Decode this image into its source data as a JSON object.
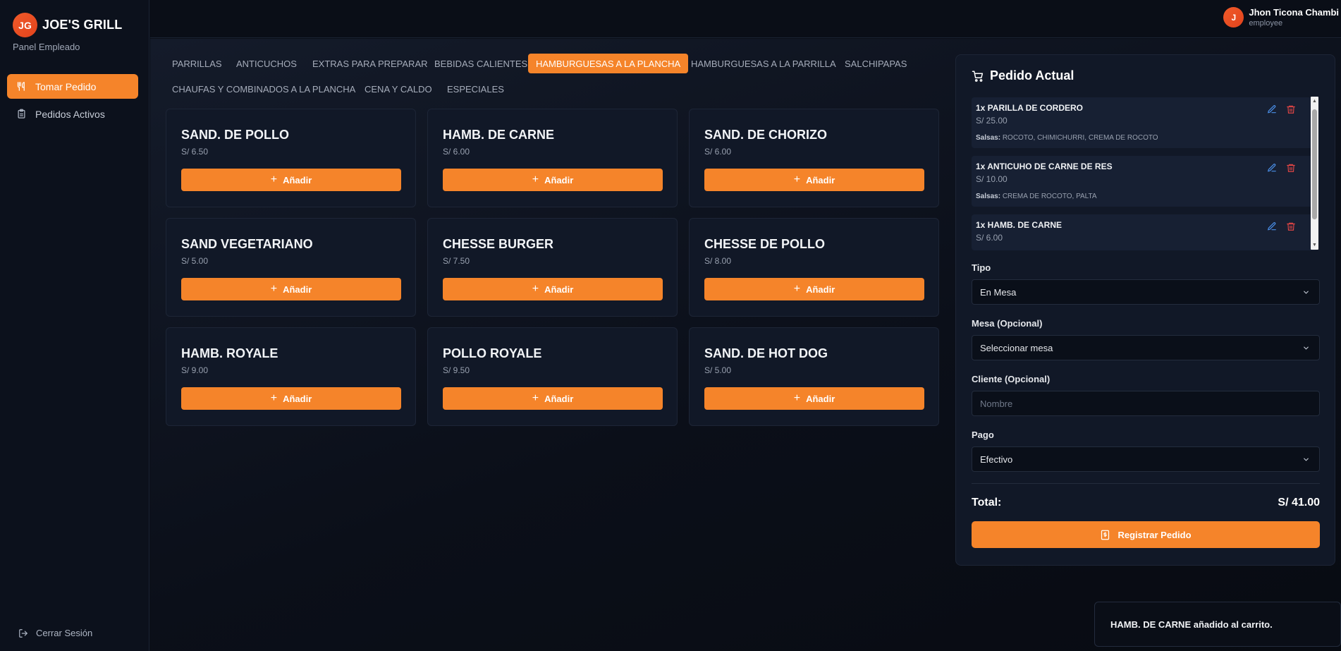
{
  "app": {
    "brand_initials": "JG",
    "brand_name": "JOE'S GRILL",
    "panel_label": "Panel Empleado"
  },
  "colors": {
    "accent": "#f5842a",
    "background": "#0a0e17",
    "card": "#111827",
    "danger": "#e04545",
    "edit": "#4a8fe8"
  },
  "sidebar": {
    "items": [
      {
        "label": "Tomar Pedido",
        "icon": "utensils-icon",
        "active": true
      },
      {
        "label": "Pedidos Activos",
        "icon": "clipboard-icon",
        "active": false
      }
    ],
    "logout_label": "Cerrar Sesión"
  },
  "user": {
    "initial": "J",
    "name": "Jhon Ticona Chambi",
    "role": "employee"
  },
  "categories": [
    {
      "label": "PARRILLAS",
      "active": false
    },
    {
      "label": "ANTICUCHOS",
      "active": false
    },
    {
      "label": "EXTRAS PARA PREPARAR",
      "active": false
    },
    {
      "label": "BEBIDAS CALIENTES",
      "active": false
    },
    {
      "label": "HAMBURGUESAS A LA PLANCHA",
      "active": true
    },
    {
      "label": "HAMBURGUESAS A LA PARRILLA",
      "active": false
    },
    {
      "label": "SALCHIPAPAS",
      "active": false
    },
    {
      "label": "CHAUFAS Y COMBINADOS A LA PLANCHA",
      "active": false
    },
    {
      "label": "CENA Y CALDO",
      "active": false
    },
    {
      "label": "ESPECIALES",
      "active": false
    }
  ],
  "add_label": "Añadir",
  "products": [
    {
      "name": "SAND. DE POLLO",
      "price": "S/ 6.50"
    },
    {
      "name": "HAMB. DE CARNE",
      "price": "S/ 6.00"
    },
    {
      "name": "SAND. DE CHORIZO",
      "price": "S/ 6.00"
    },
    {
      "name": "SAND VEGETARIANO",
      "price": "S/ 5.00"
    },
    {
      "name": "CHESSE BURGER",
      "price": "S/ 7.50"
    },
    {
      "name": "CHESSE DE POLLO",
      "price": "S/ 8.00"
    },
    {
      "name": "HAMB. ROYALE",
      "price": "S/ 9.00"
    },
    {
      "name": "POLLO ROYALE",
      "price": "S/ 9.50"
    },
    {
      "name": "SAND. DE HOT DOG",
      "price": "S/ 5.00"
    }
  ],
  "order": {
    "title": "Pedido Actual",
    "sauce_label": "Salsas:",
    "items": [
      {
        "name": "1x PARILLA DE CORDERO",
        "price": "S/ 25.00",
        "sauces": "ROCOTO, CHIMICHURRI, CREMA DE ROCOTO"
      },
      {
        "name": "1x ANTICUHO DE CARNE DE RES",
        "price": "S/ 10.00",
        "sauces": "CREMA DE ROCOTO, PALTA"
      },
      {
        "name": "1x HAMB. DE CARNE",
        "price": "S/ 6.00",
        "sauces": ""
      }
    ],
    "tipo_label": "Tipo",
    "tipo_value": "En Mesa",
    "mesa_label": "Mesa (Opcional)",
    "mesa_value": "Seleccionar mesa",
    "cliente_label": "Cliente (Opcional)",
    "cliente_placeholder": "Nombre",
    "pago_label": "Pago",
    "pago_value": "Efectivo",
    "total_label": "Total:",
    "total_value": "S/ 41.00",
    "submit_label": "Registrar Pedido"
  },
  "toast": {
    "message": "HAMB. DE CARNE añadido al carrito."
  }
}
